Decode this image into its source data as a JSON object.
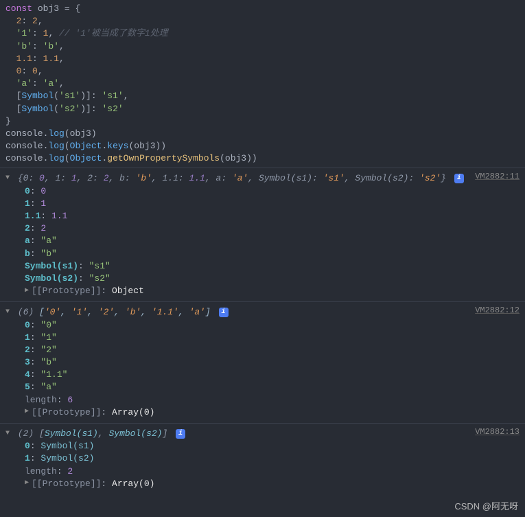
{
  "code": {
    "lines": [
      [
        [
          "kw",
          "const"
        ],
        [
          "pl",
          " obj3 "
        ],
        [
          "pl",
          "= "
        ],
        [
          "pl",
          "{"
        ]
      ],
      [
        [
          "pl",
          "  "
        ],
        [
          "num",
          "2"
        ],
        [
          "pl",
          ": "
        ],
        [
          "num",
          "2"
        ],
        [
          "pl",
          ","
        ]
      ],
      [
        [
          "pl",
          "  "
        ],
        [
          "str",
          "'1'"
        ],
        [
          "pl",
          ": "
        ],
        [
          "num",
          "1"
        ],
        [
          "pl",
          ", "
        ],
        [
          "cm",
          "// '1'被当成了数字1处理"
        ]
      ],
      [
        [
          "pl",
          "  "
        ],
        [
          "str",
          "'b'"
        ],
        [
          "pl",
          ": "
        ],
        [
          "str",
          "'b'"
        ],
        [
          "pl",
          ","
        ]
      ],
      [
        [
          "pl",
          "  "
        ],
        [
          "num",
          "1.1"
        ],
        [
          "pl",
          ": "
        ],
        [
          "num",
          "1.1"
        ],
        [
          "pl",
          ","
        ]
      ],
      [
        [
          "pl",
          "  "
        ],
        [
          "num",
          "0"
        ],
        [
          "pl",
          ": "
        ],
        [
          "num",
          "0"
        ],
        [
          "pl",
          ","
        ]
      ],
      [
        [
          "pl",
          "  "
        ],
        [
          "str",
          "'a'"
        ],
        [
          "pl",
          ": "
        ],
        [
          "str",
          "'a'"
        ],
        [
          "pl",
          ","
        ]
      ],
      [
        [
          "pl",
          "  ["
        ],
        [
          "sym",
          "Symbol"
        ],
        [
          "pl",
          "("
        ],
        [
          "str",
          "'s1'"
        ],
        [
          "pl",
          ")]: "
        ],
        [
          "str",
          "'s1'"
        ],
        [
          "pl",
          ","
        ]
      ],
      [
        [
          "pl",
          "  ["
        ],
        [
          "sym",
          "Symbol"
        ],
        [
          "pl",
          "("
        ],
        [
          "str",
          "'s2'"
        ],
        [
          "pl",
          ")]: "
        ],
        [
          "str",
          "'s2'"
        ]
      ],
      [
        [
          "pl",
          "}"
        ]
      ],
      [
        [
          "pl",
          "console."
        ],
        [
          "sym",
          "log"
        ],
        [
          "pl",
          "(obj3)"
        ]
      ],
      [
        [
          "pl",
          "console."
        ],
        [
          "sym",
          "log"
        ],
        [
          "pl",
          "("
        ],
        [
          "sym",
          "Object"
        ],
        [
          "pl",
          "."
        ],
        [
          "sym",
          "keys"
        ],
        [
          "pl",
          "(obj3))"
        ]
      ],
      [
        [
          "pl",
          "console."
        ],
        [
          "sym",
          "log"
        ],
        [
          "pl",
          "("
        ],
        [
          "sym",
          "Object"
        ],
        [
          "pl",
          "."
        ],
        [
          "fn",
          "getOwnPropertySymbols"
        ],
        [
          "pl",
          "(obj3))"
        ]
      ]
    ]
  },
  "group1": {
    "src": "VM2882:11",
    "summary": "{0: 0, 1: 1, 2: 2, b: 'b', 1.1: 1.1, a: 'a', Symbol(s1): 's1', Symbol(s2): 's2'}",
    "entries": [
      {
        "k": "0",
        "v": "0",
        "t": "num"
      },
      {
        "k": "1",
        "v": "1",
        "t": "num"
      },
      {
        "k": "1.1",
        "v": "1.1",
        "t": "num"
      },
      {
        "k": "2",
        "v": "2",
        "t": "num"
      },
      {
        "k": "a",
        "v": "\"a\"",
        "t": "str"
      },
      {
        "k": "b",
        "v": "\"b\"",
        "t": "str"
      },
      {
        "k": "Symbol(s1)",
        "v": "\"s1\"",
        "t": "str"
      },
      {
        "k": "Symbol(s2)",
        "v": "\"s2\"",
        "t": "str"
      }
    ],
    "proto": "[[Prototype]]",
    "protoval": "Object"
  },
  "group2": {
    "src": "VM2882:12",
    "summary_len": "(6)",
    "summary_arr": "['0', '1', '2', 'b', '1.1', 'a']",
    "entries": [
      {
        "k": "0",
        "v": "\"0\""
      },
      {
        "k": "1",
        "v": "\"1\""
      },
      {
        "k": "2",
        "v": "\"2\""
      },
      {
        "k": "3",
        "v": "\"b\""
      },
      {
        "k": "4",
        "v": "\"1.1\""
      },
      {
        "k": "5",
        "v": "\"a\""
      }
    ],
    "length_k": "length",
    "length_v": "6",
    "proto": "[[Prototype]]",
    "protoval": "Array(0)"
  },
  "group3": {
    "src": "VM2882:13",
    "summary_len": "(2)",
    "summary_arr": "[Symbol(s1), Symbol(s2)]",
    "entries": [
      {
        "k": "0",
        "v": "Symbol(s1)"
      },
      {
        "k": "1",
        "v": "Symbol(s2)"
      }
    ],
    "length_k": "length",
    "length_v": "2",
    "proto": "[[Prototype]]",
    "protoval": "Array(0)"
  },
  "watermark": "CSDN @阿无呀"
}
